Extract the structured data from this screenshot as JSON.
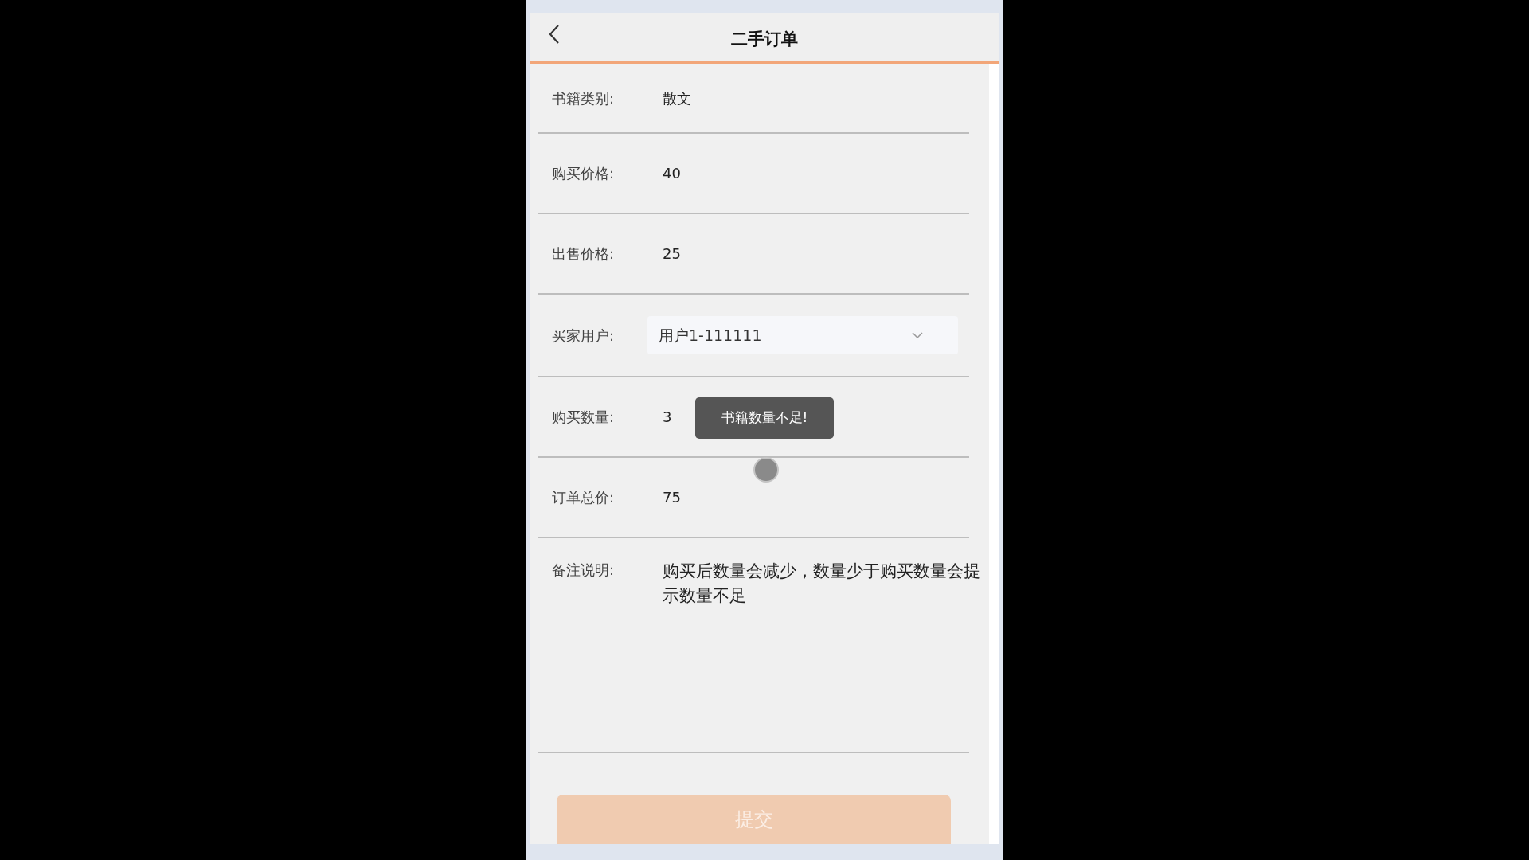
{
  "header": {
    "title": "二手订单"
  },
  "fields": [
    {
      "kind": "text",
      "label": "书籍类别:",
      "value": "散文"
    },
    {
      "kind": "text",
      "label": "购买价格:",
      "value": "40"
    },
    {
      "kind": "text",
      "label": "出售价格:",
      "value": "25"
    },
    {
      "kind": "select",
      "label": "买家用户:",
      "value": "用户1-111111"
    },
    {
      "kind": "text",
      "label": "购买数量:",
      "value": "3",
      "toast": "书籍数量不足!"
    },
    {
      "kind": "text",
      "label": "订单总价:",
      "value": "75"
    },
    {
      "kind": "note",
      "label": "备注说明:",
      "value": "购买后数量会减少，数量少于购买数量会提示数量不足"
    }
  ],
  "submit": {
    "label": "提交",
    "disabled": true
  }
}
